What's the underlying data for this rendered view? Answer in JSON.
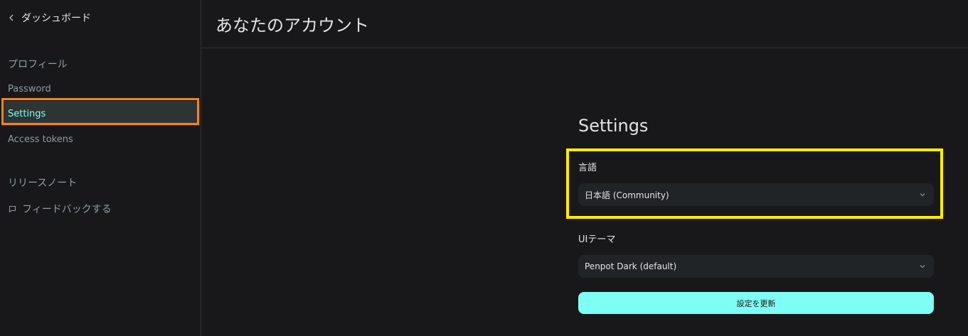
{
  "sidebar": {
    "back_label": "ダッシュボード",
    "items": [
      {
        "label": "プロフィール"
      },
      {
        "label": "Password"
      },
      {
        "label": "Settings"
      },
      {
        "label": "Access tokens"
      }
    ],
    "release_notes": "リリースノート",
    "feedback": "フィードバックする"
  },
  "header": {
    "title": "あなたのアカウント"
  },
  "form": {
    "title": "Settings",
    "language_label": "言語",
    "language_value": "日本語 (Community)",
    "theme_label": "UIテーマ",
    "theme_value": "Penpot Dark (default)",
    "submit_label": "設定を更新"
  },
  "colors": {
    "background": "#18181a",
    "accent": "#7efff5",
    "active_item_bg": "#2e3434",
    "select_bg": "#212426",
    "highlight_orange": "#f58220",
    "highlight_yellow": "#ffee00"
  },
  "icons": {
    "back": "chevron-left-icon",
    "feedback": "comment-icon",
    "select": "chevron-down-icon"
  }
}
